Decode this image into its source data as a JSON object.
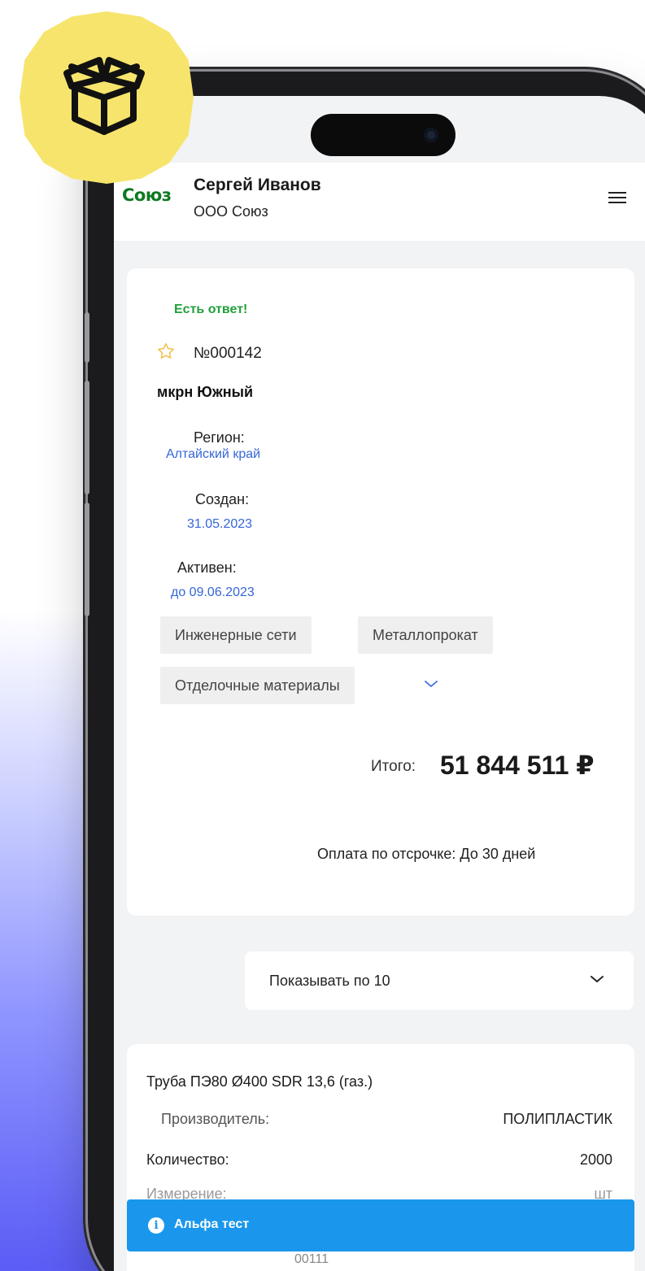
{
  "header": {
    "logo_text": "Союз",
    "user_name": "Сергей Иванов",
    "company": "ООО Союз"
  },
  "order": {
    "status": "Есть ответ!",
    "number": "№000142",
    "district": "мкрн Южный",
    "region_label": "Регион:",
    "region_value": "Алтайский край",
    "created_label": "Создан:",
    "created_value": "31.05.2023",
    "active_label": "Активен:",
    "active_value": "до 09.06.2023",
    "tags": [
      "Инженерные сети",
      "Металлопрокат",
      "Отделочные материалы"
    ],
    "total_label": "Итого:",
    "total_value": "51 844 511 ₽",
    "payment": "Оплата по отсрочке:  До 30 дней"
  },
  "pagination": {
    "select_label": "Показывать по 10"
  },
  "item": {
    "title": "Труба ПЭ80 Ø400 SDR 13,6 (газ.)",
    "manufacturer_label": "Производитель:",
    "manufacturer_value": "ПОЛИПЛАСТИК",
    "quantity_label": "Количество:",
    "quantity_value": "2000",
    "unit_label": "Измерение:",
    "unit_value": "шт",
    "code_value": "00111"
  },
  "alert": {
    "text": "Альфа тест"
  },
  "colors": {
    "accent_green": "#22a03c",
    "link_blue": "#3566d8",
    "alert_blue": "#1a97ec",
    "badge_yellow": "#f7e46c"
  },
  "icons": {
    "badge": "package-box-icon",
    "favorite": "star-outline-icon",
    "menu": "hamburger-menu-icon",
    "expand": "chevron-down-icon",
    "alert": "info-icon"
  }
}
